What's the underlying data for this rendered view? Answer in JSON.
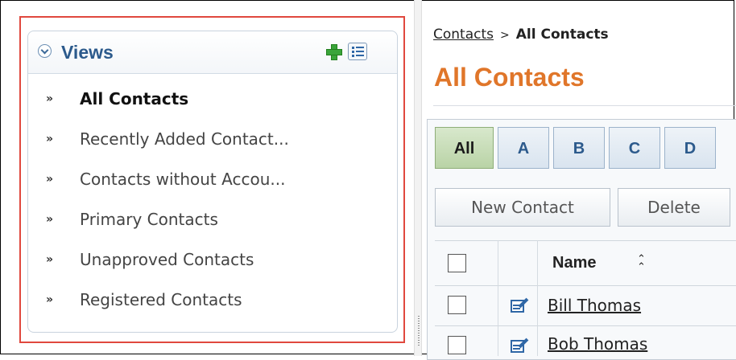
{
  "views_panel": {
    "title": "Views",
    "items": [
      {
        "label": "All Contacts",
        "active": true
      },
      {
        "label": "Recently Added Contact...",
        "active": false
      },
      {
        "label": "Contacts without Accou...",
        "active": false
      },
      {
        "label": "Primary Contacts",
        "active": false
      },
      {
        "label": "Unapproved Contacts",
        "active": false
      },
      {
        "label": "Registered Contacts",
        "active": false
      }
    ],
    "bullet": "»"
  },
  "breadcrumb": {
    "link": "Contacts",
    "separator": ">",
    "current": "All Contacts"
  },
  "page_title": "All Contacts",
  "letter_tabs": [
    "All",
    "A",
    "B",
    "C",
    "D"
  ],
  "active_tab": "All",
  "toolbar": {
    "new_label": "New Contact",
    "delete_label": "Delete"
  },
  "grid": {
    "name_header": "Name",
    "sort_glyph": "⌃⌃",
    "rows": [
      "Bill Thomas",
      "Bob Thomas"
    ]
  },
  "colors": {
    "highlight": "#e0483e",
    "views_title": "#2c5a8c",
    "page_title": "#e0762a",
    "active_tab": "#b9d3a6",
    "add_icon": "#3aa53a"
  }
}
